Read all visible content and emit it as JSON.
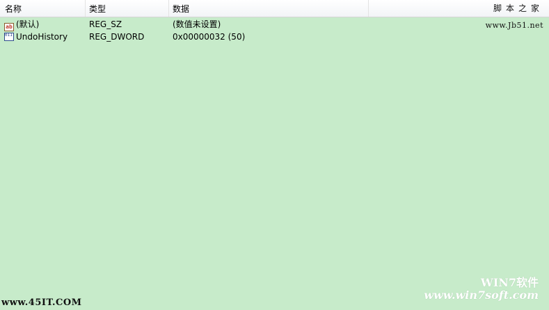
{
  "columns": {
    "name": "名称",
    "type": "类型",
    "data": "数据"
  },
  "rows": [
    {
      "icon": "string-value-icon",
      "icon_text": "ab",
      "name": "(默认)",
      "type": "REG_SZ",
      "data": "(数值未设置)"
    },
    {
      "icon": "binary-value-icon",
      "icon_text": "011 110",
      "name": "UndoHistory",
      "type": "REG_DWORD",
      "data": "0x00000032 (50)"
    }
  ],
  "watermarks": {
    "top_right_line1": "脚本之家",
    "top_right_line2": "www.Jb51.net",
    "bottom_right_line1": "WIN7软件",
    "bottom_right_line2": "www.win7soft.com",
    "bottom_left": "www.45IT.COM"
  },
  "colors": {
    "list_background": "#c7ebca",
    "header_background": "#ffffff"
  }
}
